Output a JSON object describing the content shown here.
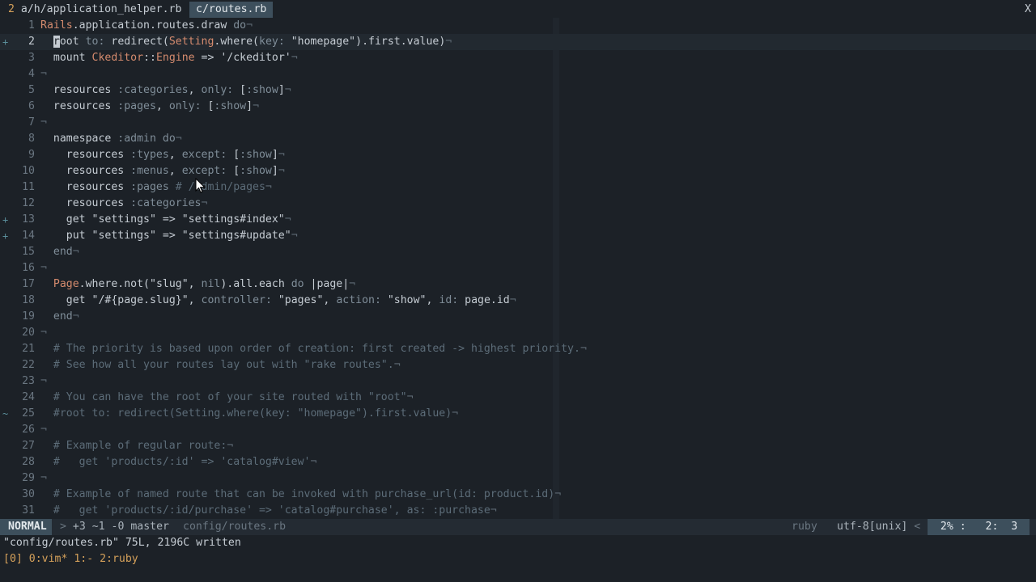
{
  "tabline": {
    "inactive_num": "2",
    "inactive_label": "a/h/application_helper.rb",
    "active_label": "c/routes.rb",
    "close": "X"
  },
  "editor": {
    "lines": [
      {
        "n": "1",
        "sign": "",
        "html": "<span class='t'>Rails</span>.application.routes.draw <span class='k'>do</span><span class='n'>¬</span>"
      },
      {
        "n": "2",
        "sign": "+",
        "html": "  <span class='blk'>r</span>oot <span class='k'>to:</span> redirect(<span class='t'>Setting</span>.where(<span class='k'>key:</span> <span class='s'>\"homepage\"</span>).first.value)<span class='n'>¬</span>",
        "cur": true
      },
      {
        "n": "3",
        "sign": "",
        "html": "  mount <span class='t'>Ckeditor</span>::<span class='t'>Engine</span> => <span class='s'>'/ckeditor'</span><span class='n'>¬</span>"
      },
      {
        "n": "4",
        "sign": "",
        "html": "<span class='n'>¬</span>"
      },
      {
        "n": "5",
        "sign": "",
        "html": "  resources <span class='k'>:categories</span>, <span class='k'>only:</span> [<span class='k'>:show</span>]<span class='n'>¬</span>"
      },
      {
        "n": "6",
        "sign": "",
        "html": "  resources <span class='k'>:pages</span>, <span class='k'>only:</span> [<span class='k'>:show</span>]<span class='n'>¬</span>"
      },
      {
        "n": "7",
        "sign": "",
        "html": "<span class='n'>¬</span>"
      },
      {
        "n": "8",
        "sign": "",
        "html": "  namespace <span class='k'>:admin</span> <span class='k'>do</span><span class='n'>¬</span>"
      },
      {
        "n": "9",
        "sign": "",
        "html": "    resources <span class='k'>:types</span>, <span class='k'>except:</span> [<span class='k'>:show</span>]<span class='n'>¬</span>"
      },
      {
        "n": "10",
        "sign": "",
        "html": "    resources <span class='k'>:menus</span>, <span class='k'>except:</span> [<span class='k'>:show</span>]<span class='n'>¬</span>"
      },
      {
        "n": "11",
        "sign": "",
        "html": "    resources <span class='k'>:pages</span> <span class='c'># /admin/pages</span><span class='n'>¬</span>"
      },
      {
        "n": "12",
        "sign": "",
        "html": "    resources <span class='k'>:categories</span><span class='n'>¬</span>"
      },
      {
        "n": "13",
        "sign": "+",
        "html": "    get <span class='s'>\"settings\"</span> => <span class='s'>\"settings#index\"</span><span class='n'>¬</span>"
      },
      {
        "n": "14",
        "sign": "+",
        "html": "    put <span class='s'>\"settings\"</span> => <span class='s'>\"settings#update\"</span><span class='n'>¬</span>"
      },
      {
        "n": "15",
        "sign": "",
        "html": "  <span class='k'>end</span><span class='n'>¬</span>"
      },
      {
        "n": "16",
        "sign": "",
        "html": "<span class='n'>¬</span>"
      },
      {
        "n": "17",
        "sign": "",
        "html": "  <span class='t'>Page</span>.where.not(<span class='s'>\"slug\"</span>, <span class='k'>nil</span>).all.each <span class='k'>do</span> |page|<span class='n'>¬</span>"
      },
      {
        "n": "18",
        "sign": "",
        "html": "    get <span class='s'>\"/#{</span>page.slug<span class='s'>}\"</span>, <span class='k'>controller:</span> <span class='s'>\"pages\"</span>, <span class='k'>action:</span> <span class='s'>\"show\"</span>, <span class='k'>id:</span> page.id<span class='n'>¬</span>"
      },
      {
        "n": "19",
        "sign": "",
        "html": "  <span class='k'>end</span><span class='n'>¬</span>"
      },
      {
        "n": "20",
        "sign": "",
        "html": "<span class='n'>¬</span>"
      },
      {
        "n": "21",
        "sign": "",
        "html": "  <span class='c'># The priority is based upon order of creation: first created -> highest priority.</span><span class='n'>¬</span>"
      },
      {
        "n": "22",
        "sign": "",
        "html": "  <span class='c'># See how all your routes lay out with \"rake routes\".</span><span class='n'>¬</span>"
      },
      {
        "n": "23",
        "sign": "",
        "html": "<span class='n'>¬</span>"
      },
      {
        "n": "24",
        "sign": "",
        "html": "  <span class='c'># You can have the root of your site routed with \"root\"</span><span class='n'>¬</span>"
      },
      {
        "n": "25",
        "sign": "~",
        "html": "  <span class='c'>#root to: redirect(Setting.where(key: \"homepage\").first.value)</span><span class='n'>¬</span>"
      },
      {
        "n": "26",
        "sign": "",
        "html": "<span class='n'>¬</span>"
      },
      {
        "n": "27",
        "sign": "",
        "html": "  <span class='c'># Example of regular route:</span><span class='n'>¬</span>"
      },
      {
        "n": "28",
        "sign": "",
        "html": "  <span class='c'>#   get 'products/:id' => 'catalog#view'</span><span class='n'>¬</span>"
      },
      {
        "n": "29",
        "sign": "",
        "html": "<span class='n'>¬</span>"
      },
      {
        "n": "30",
        "sign": "",
        "html": "  <span class='c'># Example of named route that can be invoked with purchase_url(id: product.id)</span><span class='n'>¬</span>"
      },
      {
        "n": "31",
        "sign": "",
        "html": "  <span class='c'>#   get 'products/:id/purchase' => 'catalog#purchase', as: :purchase</span><span class='n'>¬</span>"
      }
    ]
  },
  "status": {
    "mode": "NORMAL",
    "arrow": ">",
    "git": "+3 ~1 -0 master",
    "filename": "config/routes.rb",
    "filetype": "ruby",
    "encoding": "utf-8[unix]",
    "enc_sep": "<",
    "percent": "2%",
    "colon": ":",
    "line": "2:",
    "col": "3"
  },
  "cmdline": "\"config/routes.rb\" 75L, 2196C written",
  "tmux": "[0] 0:vim* 1:- 2:ruby"
}
